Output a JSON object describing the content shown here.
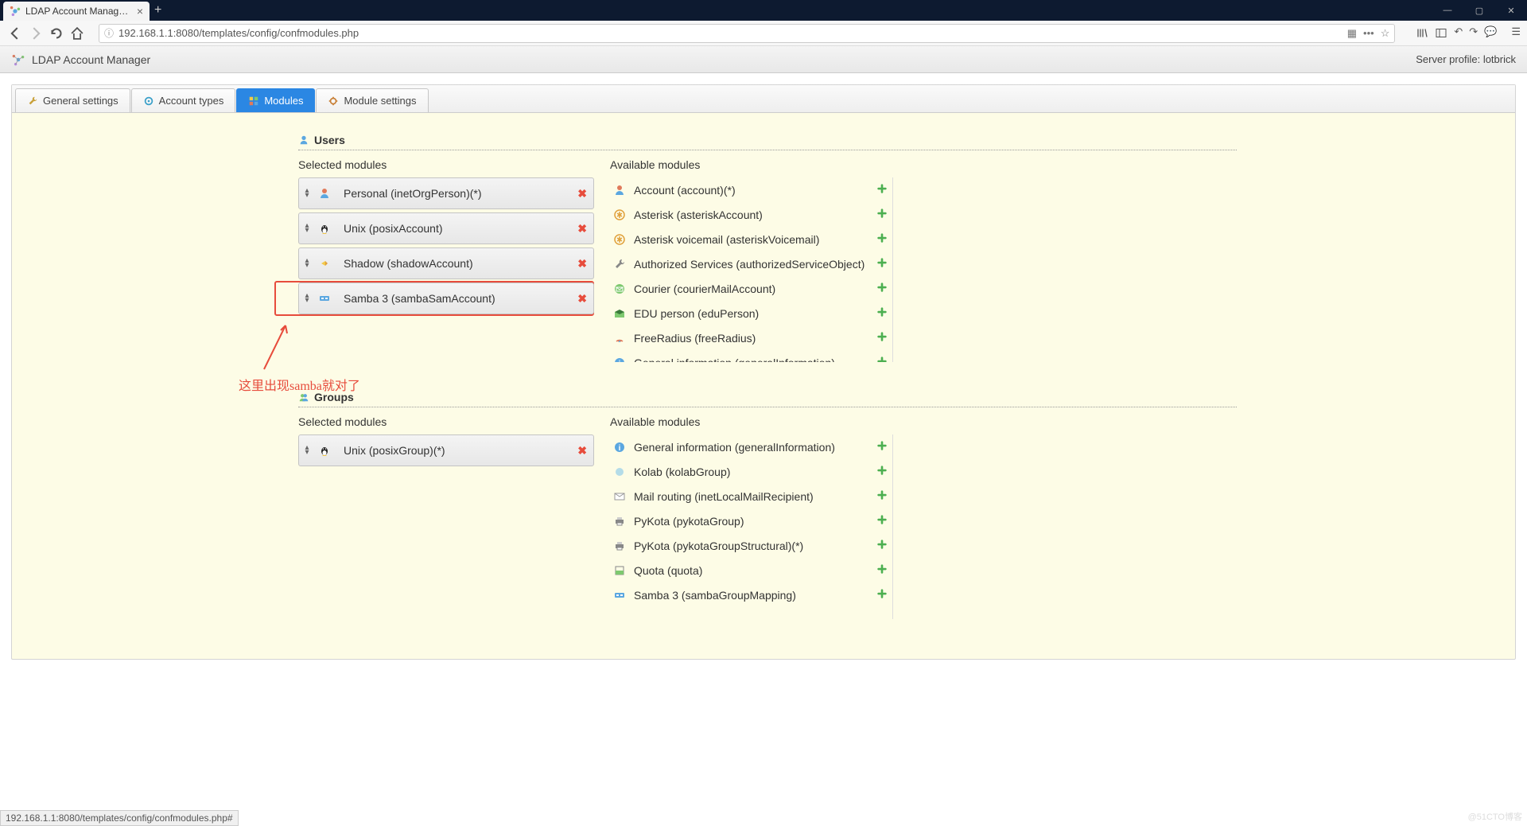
{
  "browser": {
    "tab_title": "LDAP Account Manager Con",
    "url": "192.168.1.1:8080/templates/config/confmodules.php",
    "status_url": "192.168.1.1:8080/templates/config/confmodules.php#"
  },
  "app": {
    "title": "LDAP Account Manager",
    "profile_label": "Server profile:",
    "profile_name": "lotbrick"
  },
  "tabs": {
    "general": "General settings",
    "account_types": "Account types",
    "modules": "Modules",
    "module_settings": "Module settings"
  },
  "sections": {
    "users": {
      "title": "Users",
      "selected_label": "Selected modules",
      "available_label": "Available modules",
      "selected": [
        {
          "label": "Personal (inetOrgPerson)(*)",
          "icon": "person"
        },
        {
          "label": "Unix (posixAccount)",
          "icon": "tux"
        },
        {
          "label": "Shadow (shadowAccount)",
          "icon": "shadow"
        },
        {
          "label": "Samba 3 (sambaSamAccount)",
          "icon": "samba"
        }
      ],
      "available": [
        {
          "label": "Account (account)(*)",
          "icon": "person"
        },
        {
          "label": "Asterisk (asteriskAccount)",
          "icon": "asterisk"
        },
        {
          "label": "Asterisk voicemail (asteriskVoicemail)",
          "icon": "asterisk"
        },
        {
          "label": "Authorized Services (authorizedServiceObject)",
          "icon": "wrench"
        },
        {
          "label": "Courier (courierMailAccount)",
          "icon": "mail"
        },
        {
          "label": "EDU person (eduPerson)",
          "icon": "edu"
        },
        {
          "label": "FreeRadius (freeRadius)",
          "icon": "radius"
        },
        {
          "label": "General information (generalInformation)",
          "icon": "info"
        }
      ]
    },
    "groups": {
      "title": "Groups",
      "selected_label": "Selected modules",
      "available_label": "Available modules",
      "selected": [
        {
          "label": "Unix (posixGroup)(*)",
          "icon": "tux"
        }
      ],
      "available": [
        {
          "label": "General information (generalInformation)",
          "icon": "info"
        },
        {
          "label": "Kolab (kolabGroup)",
          "icon": "kolab"
        },
        {
          "label": "Mail routing (inetLocalMailRecipient)",
          "icon": "mail2"
        },
        {
          "label": "PyKota (pykotaGroup)",
          "icon": "printer"
        },
        {
          "label": "PyKota (pykotaGroupStructural)(*)",
          "icon": "printer"
        },
        {
          "label": "Quota (quota)",
          "icon": "quota"
        },
        {
          "label": "Samba 3 (sambaGroupMapping)",
          "icon": "samba"
        }
      ]
    }
  },
  "annotation": {
    "text": "这里出现samba就对了"
  },
  "watermark": "@51CTO博客"
}
